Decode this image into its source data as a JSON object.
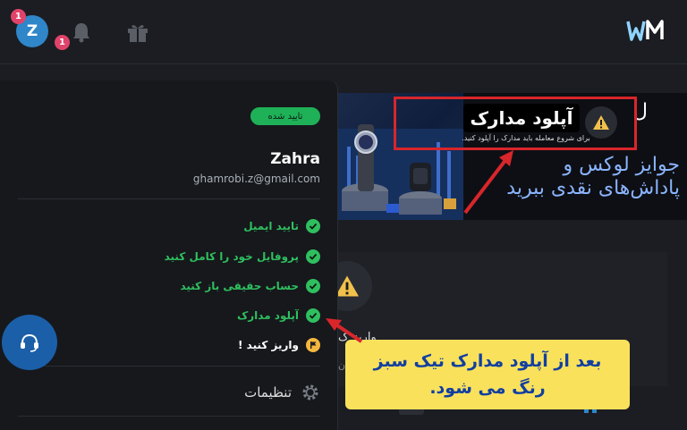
{
  "topbar": {
    "avatar_letter": "Z",
    "avatar_badge": "1",
    "bell_badge": "1",
    "logo_text": "WM"
  },
  "banner": {
    "doc_title": "آپلود مدارک",
    "doc_subtitle": "برای شروع معامله باید مدارک را آپلود کنید.",
    "headline_line1": "جوایز لوکس و",
    "headline_line2": "پاداش‌های نقدی ببرید",
    "edge_char": "ل"
  },
  "profile": {
    "status_badge": "تایید شده",
    "username": "Zahra",
    "email": "ghamrobi.z@gmail.com"
  },
  "steps": [
    {
      "label": "تایید ایمیل",
      "state": "done"
    },
    {
      "label": "پروفایل خود را کامل کنید",
      "state": "done"
    },
    {
      "label": "حساب حقیقی باز کنید",
      "state": "done"
    },
    {
      "label": "آپلود مدارک",
      "state": "done"
    },
    {
      "label": "واریز کنید !",
      "state": "pending"
    }
  ],
  "menu": {
    "settings_label": "تنظیمات"
  },
  "card": {
    "partial_text": "واریز ک",
    "partial_sub": "ان"
  },
  "annotation": {
    "line1": "بعد از آپلود مدارک تیک سبز",
    "line2": "رنگ می شود."
  },
  "colors": {
    "success": "#2fbf5f",
    "accent_blue": "#2f86c8",
    "annotation_bg": "#f9e15c",
    "annotation_text": "#123fa0",
    "highlight_red": "#d8262b",
    "pending_flag": "#f4b73f"
  },
  "icons": [
    "bell-icon",
    "gift-icon",
    "warning-icon",
    "check-icon",
    "flag-icon",
    "gear-icon",
    "headset-icon",
    "home-icon",
    "arrow-icon"
  ]
}
